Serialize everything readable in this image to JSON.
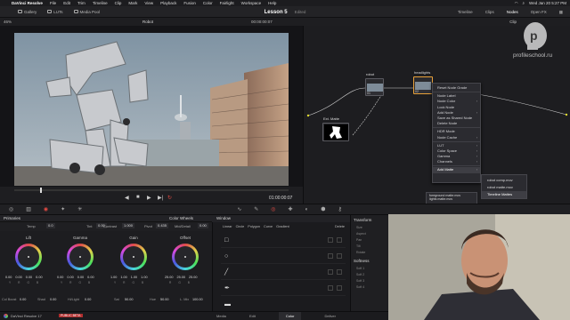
{
  "menubar": {
    "app_name": "DaVinci Resolve",
    "items": [
      "File",
      "Edit",
      "Trim",
      "Timeline",
      "Clip",
      "Mark",
      "View",
      "Playback",
      "Fusion",
      "Color",
      "Fairlight",
      "Workspace",
      "Help"
    ],
    "clock": "Wed Jan 20  5:27 PM"
  },
  "topbar": {
    "items": [
      "Gallery",
      "LUTs",
      "Media Pool"
    ],
    "project": "Lesson 5",
    "status": "Edited",
    "right": [
      "Timeline",
      "Clips",
      "Nodes",
      "Open FX"
    ],
    "active": "Nodes"
  },
  "viewer": {
    "zoom": "46%",
    "clip_name": "Robot",
    "timecode_top": "00:00:00:07",
    "timecode": "01:00:00:07"
  },
  "nodes": {
    "clip_label": "Clip",
    "items": [
      {
        "label": "robot",
        "number": "01"
      },
      {
        "label": "headlights",
        "number": "02"
      },
      {
        "label": "Ext. Matte",
        "number": ""
      }
    ]
  },
  "context_menu": {
    "items": [
      {
        "label": "Reset Node Grade",
        "sub": false
      },
      {
        "label": "Node Label",
        "sub": false
      },
      {
        "label": "Node Color",
        "sub": true
      },
      {
        "label": "Lock Node",
        "sub": false
      },
      {
        "label": "Add Node",
        "sub": true
      },
      {
        "label": "Save as Shared Node",
        "sub": false
      },
      {
        "label": "Delete Node",
        "sub": false
      },
      {
        "label": "HDR Mode",
        "sub": false
      },
      {
        "label": "Node Cache",
        "sub": true
      },
      {
        "label": "LUT",
        "sub": true
      },
      {
        "label": "Color Space",
        "sub": true
      },
      {
        "label": "Gamma",
        "sub": true
      },
      {
        "label": "Channels",
        "sub": true
      },
      {
        "label": "Add Matte",
        "sub": true
      }
    ],
    "highlighted": "Add Matte"
  },
  "submenu": {
    "items": [
      "robot comp.mov",
      "robot matte.mov",
      "Timeline Mattes"
    ],
    "highlighted": "Timeline Mattes"
  },
  "timeline_mattes": [
    "foreground matte.mov",
    "lights matte.mov"
  ],
  "primaries": {
    "title": "Primaries",
    "mode": "Color Wheels",
    "params": {
      "temp": "0.0",
      "tint": "0.00",
      "contrast": "1.000",
      "pivot": "0.435",
      "mid_detail": "0.00"
    },
    "param_labels": {
      "temp": "Temp",
      "tint": "Tint",
      "contrast": "Contrast",
      "pivot": "Pivot",
      "mid_detail": "Mid/Detail"
    },
    "wheels": [
      {
        "name": "Lift",
        "values": [
          "0.00",
          "0.00",
          "0.00",
          "0.00"
        ]
      },
      {
        "name": "Gamma",
        "values": [
          "0.00",
          "0.00",
          "0.00",
          "0.00"
        ]
      },
      {
        "name": "Gain",
        "values": [
          "1.00",
          "1.00",
          "1.00",
          "1.00"
        ]
      },
      {
        "name": "Offset",
        "values": [
          "25.00",
          "25.00",
          "25.00"
        ]
      }
    ],
    "channel_names": [
      "Y",
      "R",
      "G",
      "B"
    ],
    "bottom": {
      "col_boost_label": "Col Boost",
      "col_boost": "0.00",
      "shad_label": "Shad",
      "shad": "0.00",
      "hilight_label": "Hi/Light",
      "hilight": "0.00",
      "sat_label": "Sat",
      "sat": "50.00",
      "hue_label": "Hue",
      "hue": "50.00",
      "lmix_label": "L. Mix",
      "lmix": "100.00"
    }
  },
  "window_panel": {
    "title": "Window",
    "shapes": [
      "Linear",
      "Circle",
      "Polygon",
      "Curve",
      "Gradient"
    ],
    "delete": "Delete"
  },
  "transform": {
    "title": "Transform",
    "softness": "Softness",
    "rows": [
      "Size",
      "Aspect",
      "Pan",
      "Tilt",
      "Rotate",
      "Soft 1",
      "Soft 2",
      "Soft 3",
      "Soft 4"
    ]
  },
  "footer": {
    "app": "DaVinci Resolve 17",
    "badge": "PUBLIC BETA",
    "pages": [
      "Media",
      "Edit",
      "Color",
      "Deliver"
    ],
    "active_page": "Color"
  },
  "watermark": {
    "text": "profileschool.ru"
  }
}
